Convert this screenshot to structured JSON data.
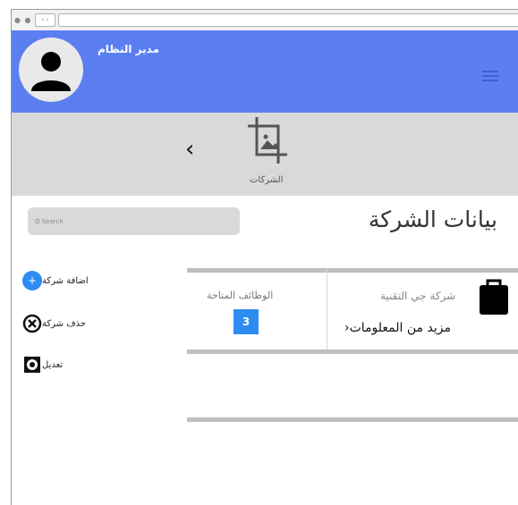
{
  "browser": {
    "nav_glyphs": "‹ ›",
    "dots": "● ● ●"
  },
  "header": {
    "username": "مدير النظام"
  },
  "section": {
    "label": "الشركات"
  },
  "search": {
    "placeholder": "Q Search"
  },
  "main": {
    "title": "بيانات الشركة"
  },
  "actions": [
    {
      "label": "اضافة شركة",
      "icon": "plus-icon"
    },
    {
      "label": "حذف شركة",
      "icon": "x-circle-icon"
    },
    {
      "label": "تعديل",
      "icon": "gear-icon"
    }
  ],
  "company_card": {
    "company_name": "شركة جي التقنية",
    "more_info": "مزيد من المعلومات",
    "jobs_label": "الوظائف المتاحة",
    "jobs_count": "3",
    "icon": "briefcase-icon"
  },
  "colors": {
    "header_blue": "#5b7ff0",
    "accent_blue": "#2d8cf0",
    "gray": "#d9d9d9"
  }
}
